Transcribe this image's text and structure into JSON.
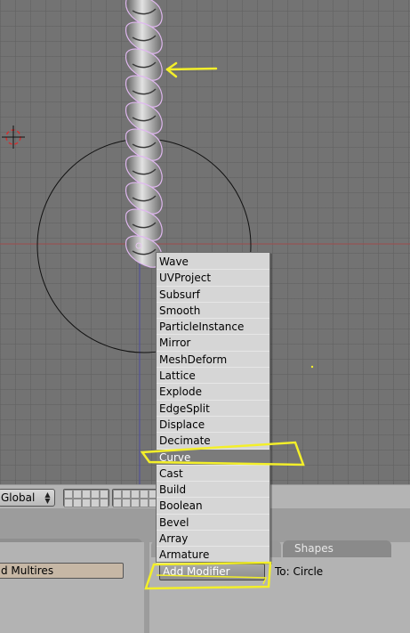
{
  "viewport": {
    "cursor_icon": "3d-cursor-icon",
    "object_icon": "twisted-spiral-mesh",
    "curve_icon": "circle-curve",
    "colors": {
      "background": "#737373",
      "grid_line": "#606060",
      "x_axis": "#9e4b4b",
      "y_axis": "#4b4b9e",
      "annotation": "#f3ef2a",
      "cursor": "#d03030"
    }
  },
  "header": {
    "transform_orientation": "Global"
  },
  "modifier_menu": {
    "items": [
      {
        "label": "Wave"
      },
      {
        "label": "UVProject"
      },
      {
        "label": "Subsurf"
      },
      {
        "label": "Smooth"
      },
      {
        "label": "ParticleInstance"
      },
      {
        "label": "Mirror"
      },
      {
        "label": "MeshDeform"
      },
      {
        "label": "Lattice"
      },
      {
        "label": "Explode"
      },
      {
        "label": "EdgeSplit"
      },
      {
        "label": "Displace"
      },
      {
        "label": "Decimate"
      },
      {
        "label": "Curve"
      },
      {
        "label": "Cast"
      },
      {
        "label": "Build"
      },
      {
        "label": "Boolean"
      },
      {
        "label": "Bevel"
      },
      {
        "label": "Array"
      },
      {
        "label": "Armature"
      }
    ],
    "selected": "Curve"
  },
  "buttons_window": {
    "tab_shapes": "Shapes",
    "multires_label": "d Multires",
    "add_modifier_label": "Add Modifier",
    "to_object_label": "To: Circle"
  }
}
